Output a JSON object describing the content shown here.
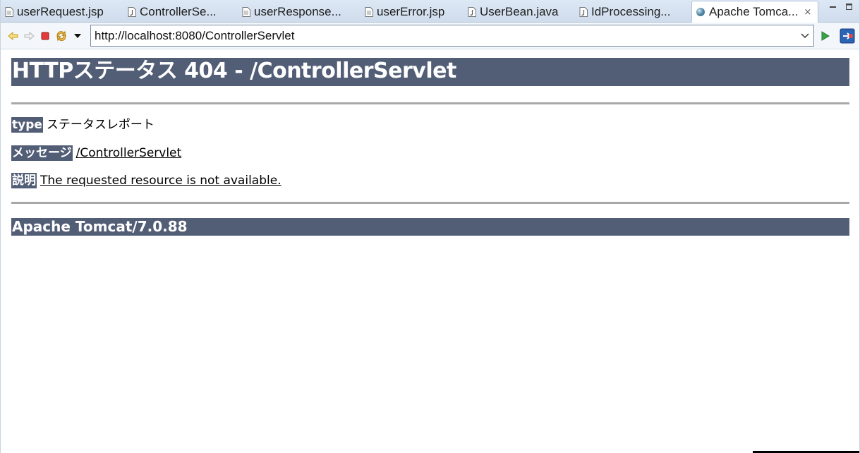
{
  "tabs": [
    {
      "label": "userRequest.jsp",
      "icon": "jsp-file-icon"
    },
    {
      "label": "ControllerSe...",
      "icon": "java-file-icon"
    },
    {
      "label": "userResponse...",
      "icon": "jsp-file-icon"
    },
    {
      "label": "userError.jsp",
      "icon": "jsp-file-icon"
    },
    {
      "label": "UserBean.java",
      "icon": "java-file-icon"
    },
    {
      "label": "IdProcessing...",
      "icon": "java-file-icon"
    },
    {
      "label": "Apache Tomca...",
      "icon": "globe-icon",
      "active": true,
      "close": "⨯"
    }
  ],
  "toolbar": {
    "url": "http://localhost:8080/ControllerServlet"
  },
  "page": {
    "heading": "HTTPステータス 404 - /ControllerServlet",
    "type_label": "type",
    "type_value": "ステータスレポート",
    "message_label": "メッセージ",
    "message_value": "/ControllerServlet",
    "description_label": "説明",
    "description_value": "The requested resource is not available.",
    "server": "Apache Tomcat/7.0.88"
  },
  "colors": {
    "heading_bg": "#525d76",
    "rule": "#a8a8a8"
  }
}
